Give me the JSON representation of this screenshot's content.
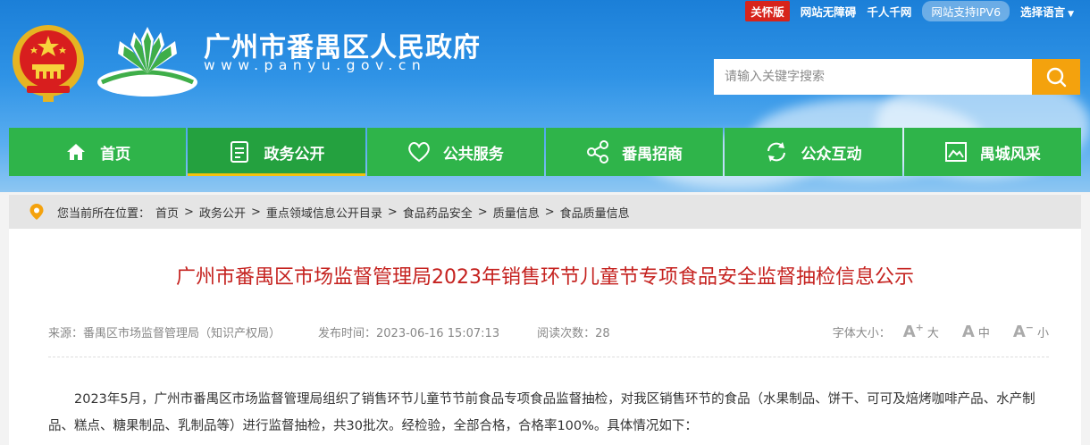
{
  "toplinks": {
    "care": "关怀版",
    "accessible": "网站无障碍",
    "thousand": "千人千网",
    "ipv6": "网站支持IPV6",
    "language": "选择语言"
  },
  "header": {
    "title": "广州市番禺区人民政府",
    "url": "www.panyu.gov.cn"
  },
  "search": {
    "placeholder": "请输入关键字搜索"
  },
  "nav": {
    "items": [
      {
        "label": "首页",
        "icon": "home-icon"
      },
      {
        "label": "政务公开",
        "icon": "document-icon"
      },
      {
        "label": "公共服务",
        "icon": "heart-icon"
      },
      {
        "label": "番禺招商",
        "icon": "share-icon"
      },
      {
        "label": "公众互动",
        "icon": "refresh-icon"
      },
      {
        "label": "禺城风采",
        "icon": "picture-icon"
      }
    ],
    "active_index": 1
  },
  "breadcrumb": {
    "prefix": "您当前所在位置：",
    "items": [
      "首页",
      "政务公开",
      "重点领域信息公开目录",
      "食品药品安全",
      "质量信息",
      "食品质量信息"
    ],
    "separator": ">"
  },
  "article": {
    "title": "广州市番禺区市场监督管理局2023年销售环节儿童节专项食品安全监督抽检信息公示",
    "source": "来源：番禺区市场监督管理局（知识产权局）",
    "published": "发布时间：2023-06-16 15:07:13",
    "views": "阅读次数：28",
    "font_size_label": "字体大小：",
    "font_large": "大",
    "font_medium": "中",
    "font_small": "小",
    "paragraph": "2023年5月，广州市番禺区市场监督管理局组织了销售环节儿童节节前食品专项食品监督抽检，对我区销售环节的食品（水果制品、饼干、可可及焙烤咖啡产品、水产制品、糕点、糖果制品、乳制品等）进行监督抽检，共30批次。经检验，全部合格，合格率100%。具体情况如下："
  },
  "colors": {
    "banner_top": "#1b7fd8",
    "nav_green": "#2fb44a",
    "search_button": "#f4a20d",
    "title_red": "#c5221f",
    "care_red": "#d7241b"
  }
}
